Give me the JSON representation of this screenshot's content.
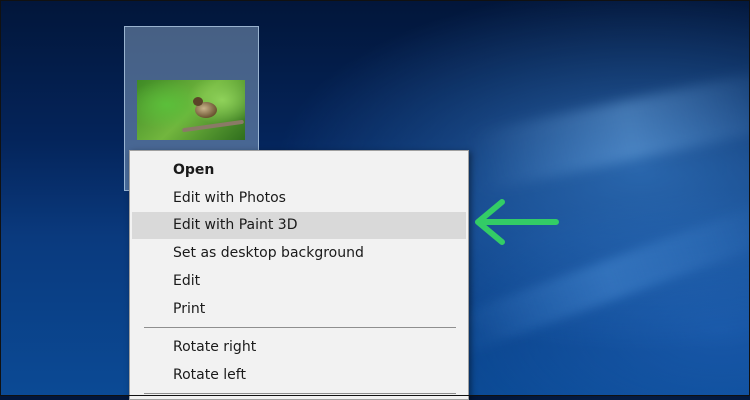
{
  "context_menu": {
    "items": [
      {
        "label": "Open"
      },
      {
        "label": "Edit with Photos"
      },
      {
        "label": "Edit with Paint 3D"
      },
      {
        "label": "Set as desktop background"
      },
      {
        "label": "Edit"
      },
      {
        "label": "Print"
      },
      {
        "label": "Rotate right"
      },
      {
        "label": "Rotate left"
      }
    ],
    "highlighted_item": "Edit with Paint 3D"
  },
  "desktop_icon": {
    "thumbnail": "bird-photo-thumbnail"
  },
  "annotation": {
    "icon": "arrow-left-icon",
    "color": "#33cc66"
  },
  "colors": {
    "menu_bg": "#f2f2f2",
    "highlight": "#d9d9d9",
    "desktop": "#0a3a7e"
  }
}
